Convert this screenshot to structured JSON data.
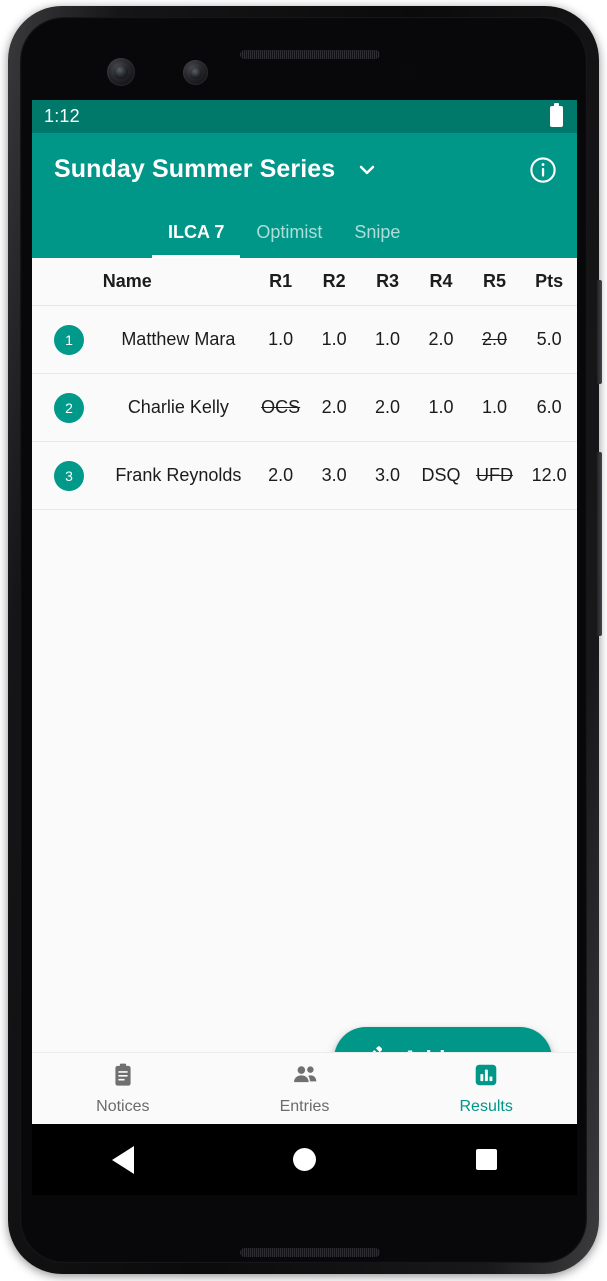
{
  "status_bar": {
    "time": "1:12",
    "battery_icon": "battery-full-icon"
  },
  "app_bar": {
    "title": "Sunday Summer Series",
    "dropdown_icon": "chevron-down-icon",
    "info_icon": "info-circle-icon"
  },
  "tabs": [
    {
      "label": "ILCA 7",
      "active": true
    },
    {
      "label": "Optimist",
      "active": false
    },
    {
      "label": "Snipe",
      "active": false
    }
  ],
  "results_table": {
    "columns": [
      "Name",
      "R1",
      "R2",
      "R3",
      "R4",
      "R5",
      "Pts"
    ],
    "rows": [
      {
        "rank": "1",
        "name": "Matthew Mara",
        "scores": [
          {
            "value": "1.0",
            "discarded": false
          },
          {
            "value": "1.0",
            "discarded": false
          },
          {
            "value": "1.0",
            "discarded": false
          },
          {
            "value": "2.0",
            "discarded": false
          },
          {
            "value": "2.0",
            "discarded": true
          }
        ],
        "points": "5.0"
      },
      {
        "rank": "2",
        "name": "Charlie Kelly",
        "scores": [
          {
            "value": "OCS",
            "discarded": true
          },
          {
            "value": "2.0",
            "discarded": false
          },
          {
            "value": "2.0",
            "discarded": false
          },
          {
            "value": "1.0",
            "discarded": false
          },
          {
            "value": "1.0",
            "discarded": false
          }
        ],
        "points": "6.0"
      },
      {
        "rank": "3",
        "name": "Frank Reynolds",
        "scores": [
          {
            "value": "2.0",
            "discarded": false
          },
          {
            "value": "3.0",
            "discarded": false
          },
          {
            "value": "3.0",
            "discarded": false
          },
          {
            "value": "DSQ",
            "discarded": false
          },
          {
            "value": "UFD",
            "discarded": true
          }
        ],
        "points": "12.0"
      }
    ]
  },
  "fab": {
    "label": "Add scores",
    "icon": "pencil-edit-icon"
  },
  "bottom_nav": [
    {
      "label": "Notices",
      "icon": "clipboard-icon",
      "active": false
    },
    {
      "label": "Entries",
      "icon": "people-icon",
      "active": false
    },
    {
      "label": "Results",
      "icon": "bar-chart-icon",
      "active": true
    }
  ],
  "android_nav": {
    "back": "back-triangle-icon",
    "home": "home-circle-icon",
    "recents": "recents-square-icon"
  },
  "colors": {
    "primary": "#009688",
    "primary_dark": "#00796b",
    "accent": "#00998a",
    "background": "#fafafa",
    "text": "#1c1c1c",
    "text_muted": "#6b6b6b"
  }
}
